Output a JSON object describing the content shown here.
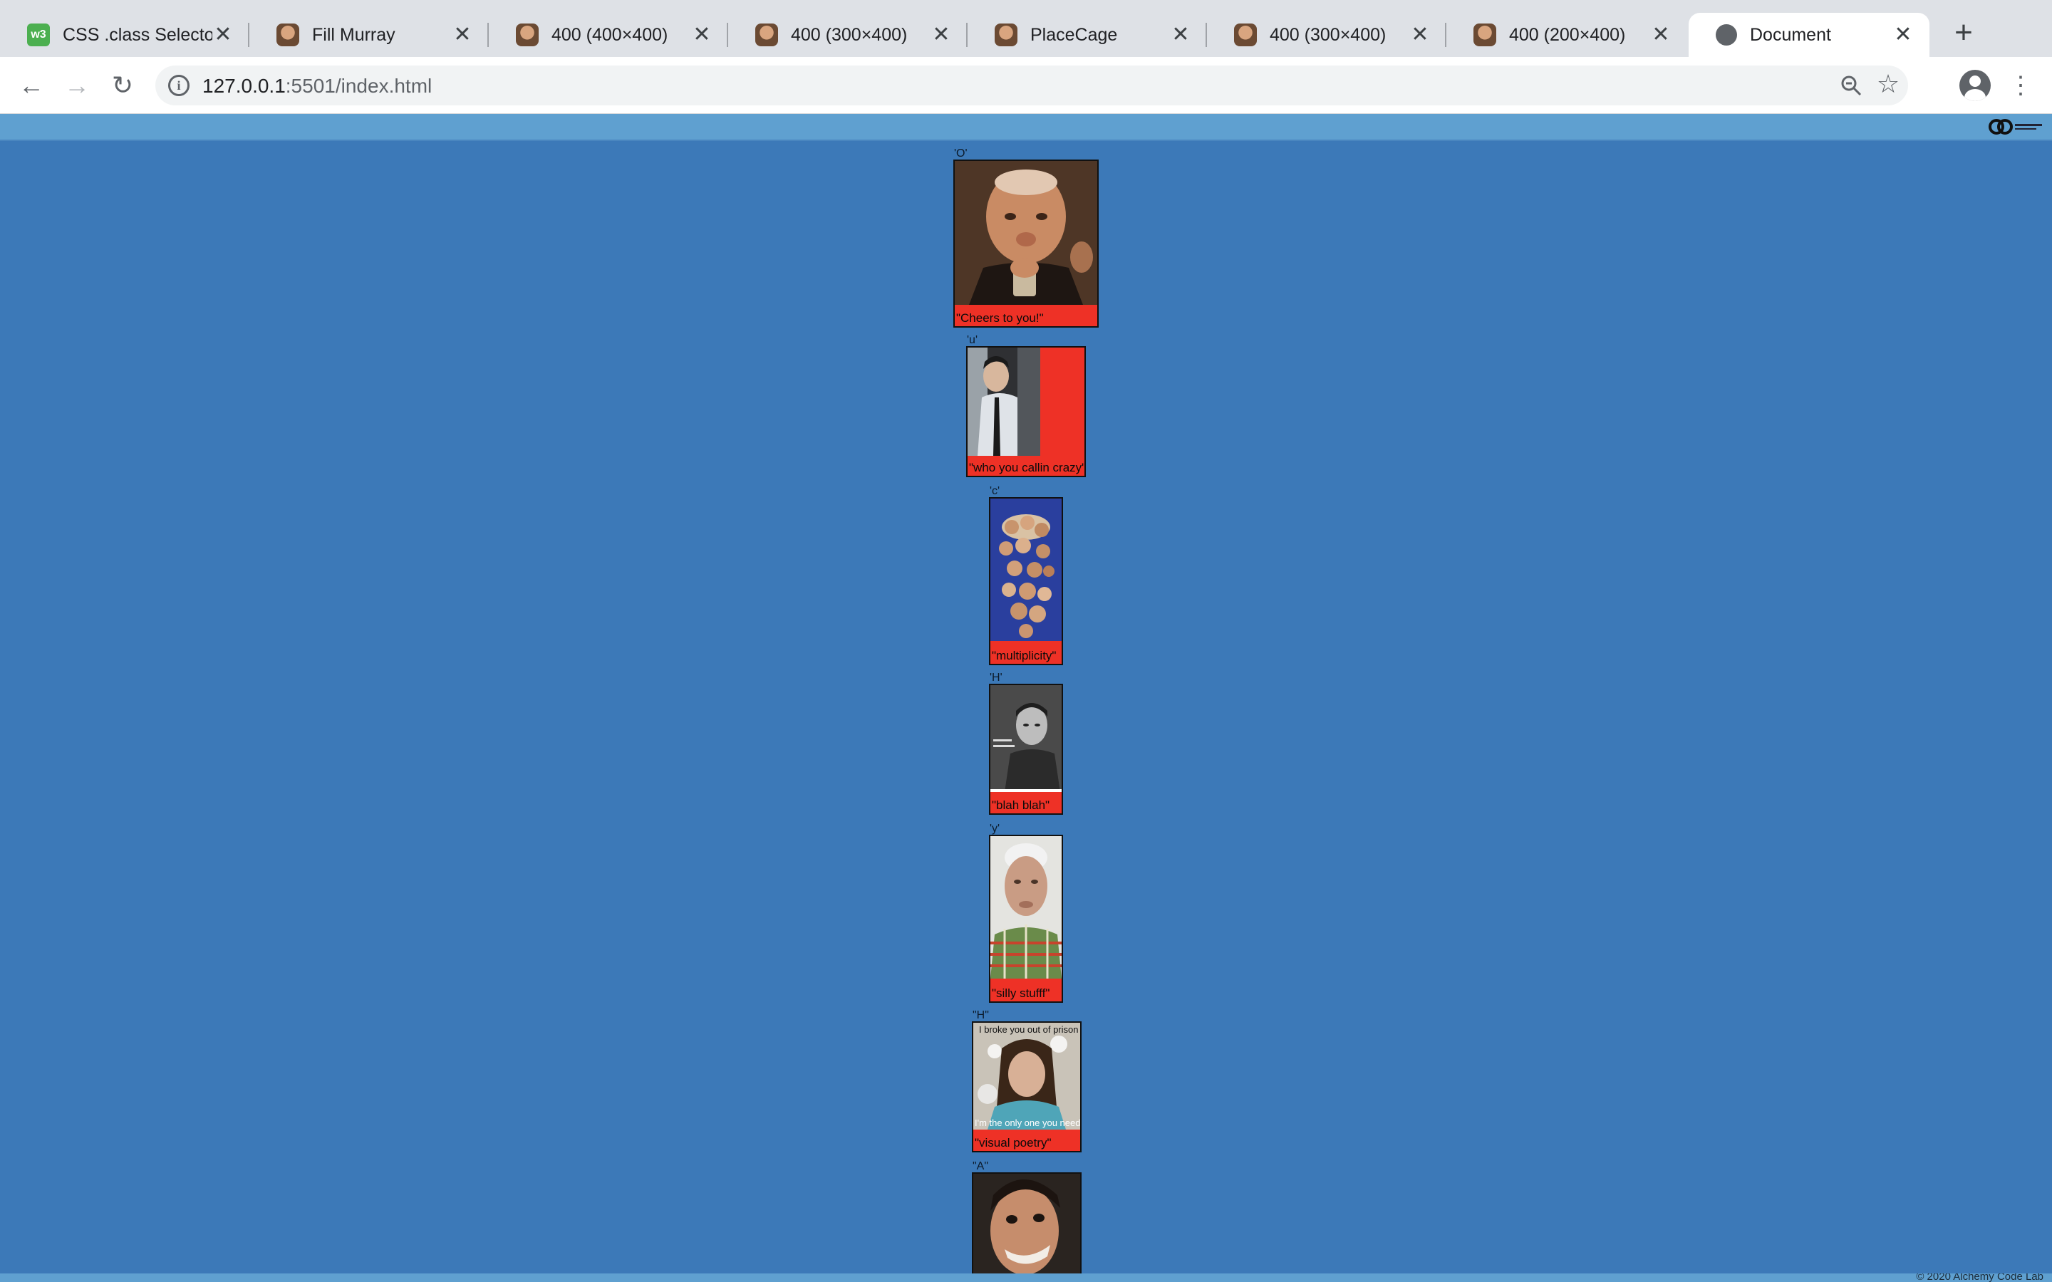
{
  "browser": {
    "tabs": [
      {
        "title": "CSS .class Selecto",
        "favicon": "w3schools-icon",
        "favicon_text": "w3"
      },
      {
        "title": "Fill Murray",
        "favicon": "murray-favicon"
      },
      {
        "title": "400 (400×400)",
        "favicon": "murray-favicon"
      },
      {
        "title": "400 (300×400)",
        "favicon": "murray-favicon"
      },
      {
        "title": "PlaceCage",
        "favicon": "murray-favicon"
      },
      {
        "title": "400 (300×400)",
        "favicon": "murray-favicon"
      },
      {
        "title": "400 (200×400)",
        "favicon": "murray-favicon"
      },
      {
        "title": "Document",
        "favicon": "globe-icon",
        "active": true
      }
    ],
    "close_glyph": "✕",
    "new_tab_glyph": "+",
    "url_host": "127.0.0.1",
    "url_rest": ":5501/index.html",
    "nav": {
      "back": "←",
      "forward": "→",
      "reload": "↻",
      "star": "☆",
      "menu": "⋮"
    }
  },
  "page": {
    "background": "#3c79b8",
    "header_color": "#5fa0d0",
    "caption_bg": "#ee3126",
    "footer_text": "© 2020 Alchemy Code Lab",
    "cards": [
      {
        "letter": "'O'",
        "caption": "\"Cheers to you!\""
      },
      {
        "letter": "'u'",
        "caption": "\"who you callin crazy\""
      },
      {
        "letter": "'c'",
        "caption": "\"multiplicity\""
      },
      {
        "letter": "'H'",
        "caption": "\"blah blah\""
      },
      {
        "letter": "'y'",
        "caption": "\"silly stufff\""
      },
      {
        "letter": "\"H\"",
        "caption": "\"visual poetry\"",
        "photo_text_top": "I broke you out of prison",
        "photo_text_bottom": "I'm the only one you need"
      },
      {
        "letter": "\"A\"",
        "caption": ""
      }
    ]
  }
}
